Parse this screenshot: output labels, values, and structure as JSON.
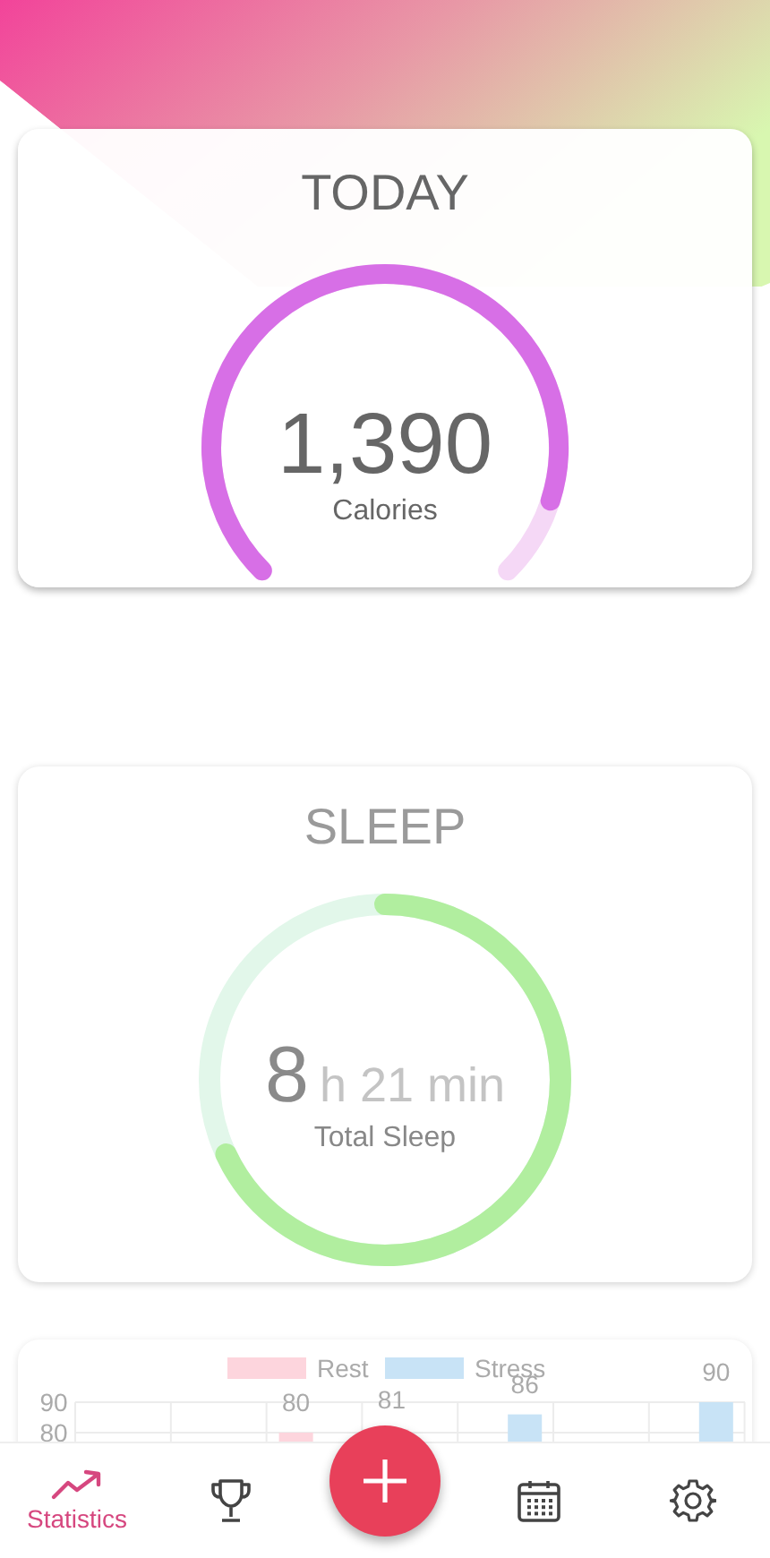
{
  "today": {
    "title": "TODAY",
    "value": "1,390",
    "unit": "Calories"
  },
  "sleep": {
    "title": "SLEEP",
    "hours": "8",
    "minutes": "h 21 min",
    "caption": "Total Sleep"
  },
  "stats": {
    "chart_data": {
      "type": "bar",
      "yticks": [
        80,
        90
      ],
      "ylim": [
        20,
        90
      ],
      "legend": "top",
      "data_labels": true,
      "series": [
        {
          "name": "Rest",
          "color": "#fdd5dd",
          "values": [
            null,
            null,
            80,
            81,
            null,
            null,
            null
          ]
        },
        {
          "name": "Stress",
          "color": "#c8e3f6",
          "values": [
            null,
            null,
            null,
            null,
            86,
            null,
            90
          ]
        }
      ]
    }
  },
  "nav": {
    "items": [
      {
        "label": "Statistics",
        "selected": true
      },
      {
        "selected": false
      },
      {
        "selected": false
      },
      {
        "selected": false
      }
    ]
  }
}
